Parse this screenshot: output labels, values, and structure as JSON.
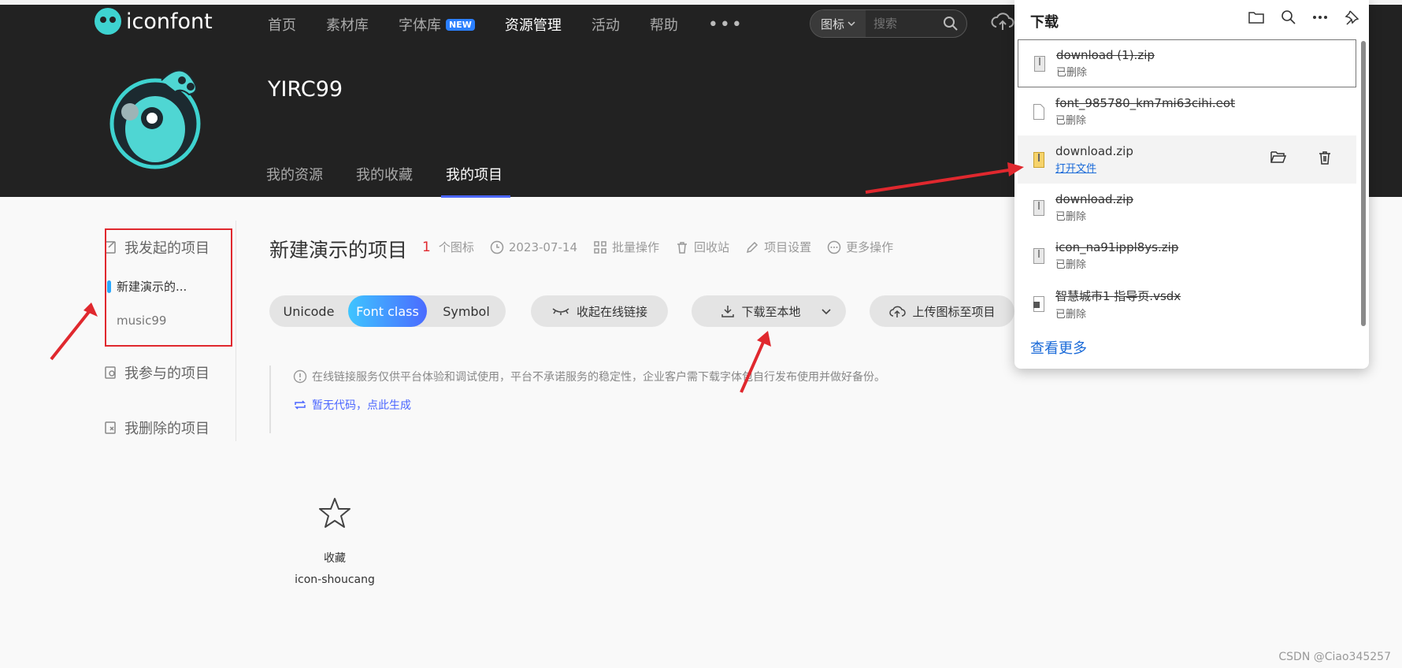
{
  "header": {
    "logo_text": "iconfont",
    "nav": [
      {
        "label": "首页",
        "active": false
      },
      {
        "label": "素材库",
        "active": false
      },
      {
        "label": "字体库",
        "active": false,
        "badge": "NEW"
      },
      {
        "label": "资源管理",
        "active": true
      },
      {
        "label": "活动",
        "active": false
      },
      {
        "label": "帮助",
        "active": false
      }
    ],
    "nav_more": "•••",
    "search": {
      "type": "图标",
      "placeholder": "搜索"
    },
    "username": "YIRC99",
    "subtabs": [
      {
        "label": "我的资源",
        "active": false
      },
      {
        "label": "我的收藏",
        "active": false
      },
      {
        "label": "我的项目",
        "active": true
      }
    ]
  },
  "sidebar": {
    "initiated": "我发起的项目",
    "projects": [
      {
        "label": "新建演示的...",
        "active": true
      },
      {
        "label": "music99",
        "active": false
      }
    ],
    "joined": "我参与的项目",
    "deleted": "我删除的项目"
  },
  "project": {
    "title": "新建演示的项目",
    "count": "1",
    "count_unit": "个图标",
    "date": "2023-07-14",
    "actions": [
      "批量操作",
      "回收站",
      "项目设置",
      "更多操作"
    ]
  },
  "toolbar": {
    "tabs": [
      {
        "label": "Unicode",
        "active": false
      },
      {
        "label": "Font class",
        "active": true
      },
      {
        "label": "Symbol",
        "active": false
      }
    ],
    "collapse_link": "收起在线链接",
    "download": "下载至本地",
    "upload": "上传图标至项目"
  },
  "notice": {
    "text": "在线链接服务仅供平台体验和调试使用，平台不承诺服务的稳定性，企业客户需下载字体包自行发布使用并做好备份。",
    "generate": "暂无代码，点此生成"
  },
  "icons": [
    {
      "name": "收藏",
      "code": "icon-shoucang"
    }
  ],
  "downloads": {
    "title": "下载",
    "items": [
      {
        "name": "download (1).zip",
        "status": "已删除",
        "deleted": true,
        "type": "zip"
      },
      {
        "name": "font_985780_km7mi63cihi.eot",
        "status": "已删除",
        "deleted": true,
        "type": "file"
      },
      {
        "name": "download.zip",
        "status": "打开文件",
        "deleted": false,
        "type": "zip"
      },
      {
        "name": "download.zip",
        "status": "已删除",
        "deleted": true,
        "type": "zip"
      },
      {
        "name": "icon_na91ippl8ys.zip",
        "status": "已删除",
        "deleted": true,
        "type": "zip"
      },
      {
        "name": "智慧城市1 指导页.vsdx",
        "status": "已删除",
        "deleted": true,
        "type": "visio"
      }
    ],
    "see_more": "查看更多"
  },
  "watermark": "CSDN @Ciao345257",
  "colors": {
    "header_bg": "#222222",
    "accent": "#4b66ff",
    "annotation_red": "#e0282e",
    "link": "#1a6ad8"
  }
}
